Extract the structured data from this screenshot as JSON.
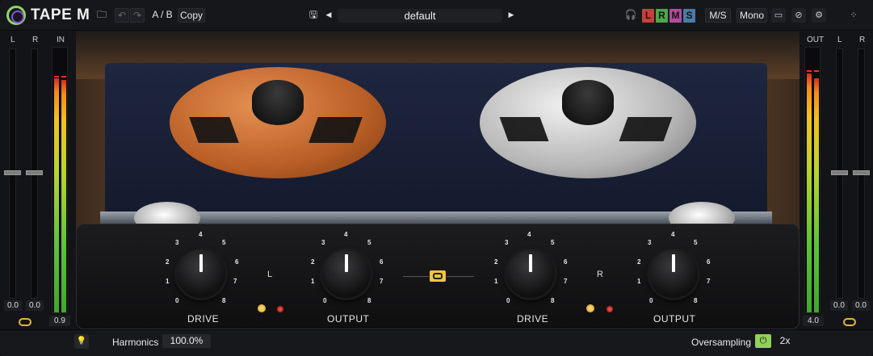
{
  "header": {
    "brand": "TAPE M",
    "ab_label": "A / B",
    "copy_label": "Copy",
    "preset_name": "default",
    "lrms": [
      "L",
      "R",
      "M",
      "S"
    ],
    "ms_label": "M/S",
    "mono_label": "Mono"
  },
  "input_meter": {
    "channel_l": "L",
    "channel_r": "R",
    "label": "IN",
    "fader_l_value": "0.0",
    "fader_r_value": "0.0",
    "gain_value": "0.9"
  },
  "output_meter": {
    "label": "OUT",
    "channel_l": "L",
    "channel_r": "R",
    "gain_value": "4.0",
    "fader_l_value": "0.0",
    "fader_r_value": "0.0"
  },
  "controls": {
    "left_channel": "L",
    "right_channel": "R",
    "scale_ticks": [
      "0",
      "1",
      "2",
      "3",
      "4",
      "5",
      "6",
      "7",
      "8"
    ],
    "left_drive_label": "DRIVE",
    "left_output_label": "OUTPUT",
    "right_drive_label": "DRIVE",
    "right_output_label": "OUTPUT"
  },
  "footer": {
    "harmonics_label": "Harmonics",
    "harmonics_value": "100.0%",
    "oversampling_label": "Oversampling",
    "oversampling_value": "2x"
  },
  "colors": {
    "accent_green": "#8fd15a",
    "accent_yellow": "#f2c440",
    "lrms_colors": [
      "#c2413b",
      "#4fa54d",
      "#b04c9c",
      "#4b7aa6"
    ]
  }
}
